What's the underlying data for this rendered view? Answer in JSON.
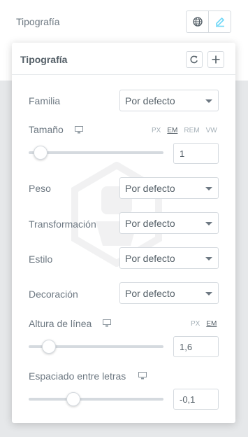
{
  "control": {
    "label": "Tipografía",
    "global_icon": "globe-icon",
    "edit_icon": "pencil-icon"
  },
  "panel": {
    "title": "Tipografía",
    "reset_icon": "reset-icon",
    "add_icon": "plus-icon",
    "familia": {
      "label": "Familia",
      "value": "Por defecto"
    },
    "tamano": {
      "label": "Tamaño",
      "device_icon": "desktop-icon",
      "units": [
        "PX",
        "EM",
        "REM",
        "VW"
      ],
      "active_unit": "EM",
      "value": "1",
      "slider_fraction": 0.09
    },
    "peso": {
      "label": "Peso",
      "value": "Por defecto"
    },
    "transformacion": {
      "label": "Transformación",
      "value": "Por defecto"
    },
    "estilo": {
      "label": "Estilo",
      "value": "Por defecto"
    },
    "decoracion": {
      "label": "Decoración",
      "value": "Por defecto"
    },
    "altura": {
      "label": "Altura de línea",
      "device_icon": "desktop-icon",
      "units": [
        "PX",
        "EM"
      ],
      "active_unit": "EM",
      "value": "1,6",
      "slider_fraction": 0.15
    },
    "espaciado": {
      "label": "Espaciado entre letras",
      "device_icon": "desktop-icon",
      "value": "-0,1",
      "slider_fraction": 0.33
    }
  },
  "colors": {
    "accent": "#71d7f7",
    "text": "#6d7882",
    "border": "#d5dadf",
    "backdrop": "#e6e8ea"
  }
}
